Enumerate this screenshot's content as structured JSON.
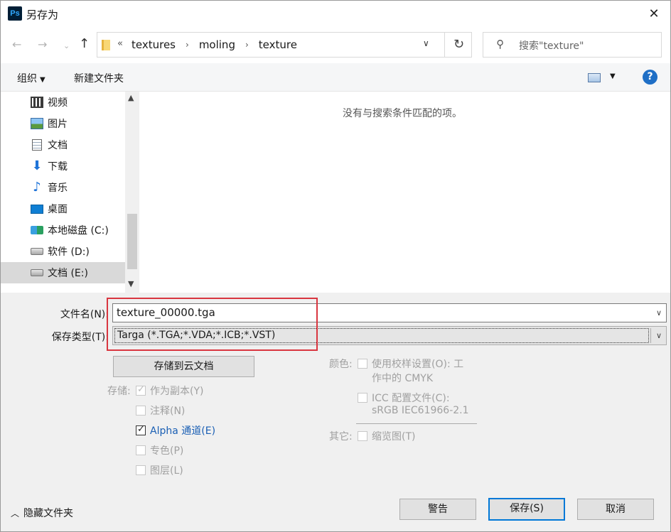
{
  "window": {
    "title": "另存为",
    "app_logo": "Ps"
  },
  "nav": {
    "crumb_prefix": "«",
    "breadcrumbs": [
      "textures",
      "moling",
      "texture"
    ],
    "search_placeholder": "搜索\"texture\""
  },
  "toolbar": {
    "organize": "组织",
    "new_folder": "新建文件夹",
    "help": "?"
  },
  "sidebar": {
    "items": [
      {
        "label": "视频",
        "icon": "video-icon"
      },
      {
        "label": "图片",
        "icon": "pictures-icon"
      },
      {
        "label": "文档",
        "icon": "documents-icon"
      },
      {
        "label": "下载",
        "icon": "download-icon"
      },
      {
        "label": "音乐",
        "icon": "music-icon"
      },
      {
        "label": "桌面",
        "icon": "desktop-icon"
      },
      {
        "label": "本地磁盘 (C:)",
        "icon": "windows-drive-icon"
      },
      {
        "label": "软件 (D:)",
        "icon": "drive-icon"
      },
      {
        "label": "文档 (E:)",
        "icon": "drive-icon",
        "selected": true
      }
    ]
  },
  "content": {
    "empty_message": "没有与搜索条件匹配的项。"
  },
  "form": {
    "filename_label": "文件名(N):",
    "filename_value": "texture_00000.tga",
    "filetype_label": "保存类型(T):",
    "filetype_value": "Targa (*.TGA;*.VDA;*.ICB;*.VST)",
    "cloud_button": "存储到云文档"
  },
  "save_options": {
    "label": "存储:",
    "as_copy": "作为副本(Y)",
    "notes": "注释(N)",
    "alpha": "Alpha 通道(E)",
    "spot": "专色(P)",
    "layers": "图层(L)"
  },
  "color_options": {
    "label": "颜色:",
    "proof_line1": "使用校样设置(O):  工",
    "proof_line2": "作中的 CMYK",
    "icc_line1": "ICC 配置文件(C):",
    "icc_line2": "sRGB IEC61966-2.1"
  },
  "other_options": {
    "label": "其它:",
    "thumbnail": "缩览图(T)"
  },
  "footer": {
    "hide_folders": "隐藏文件夹",
    "warning": "警告",
    "save": "保存(S)",
    "cancel": "取消"
  },
  "colors": {
    "accent": "#0078d7",
    "highlight_box": "#d93640",
    "link_blue": "#1a5fb4"
  }
}
